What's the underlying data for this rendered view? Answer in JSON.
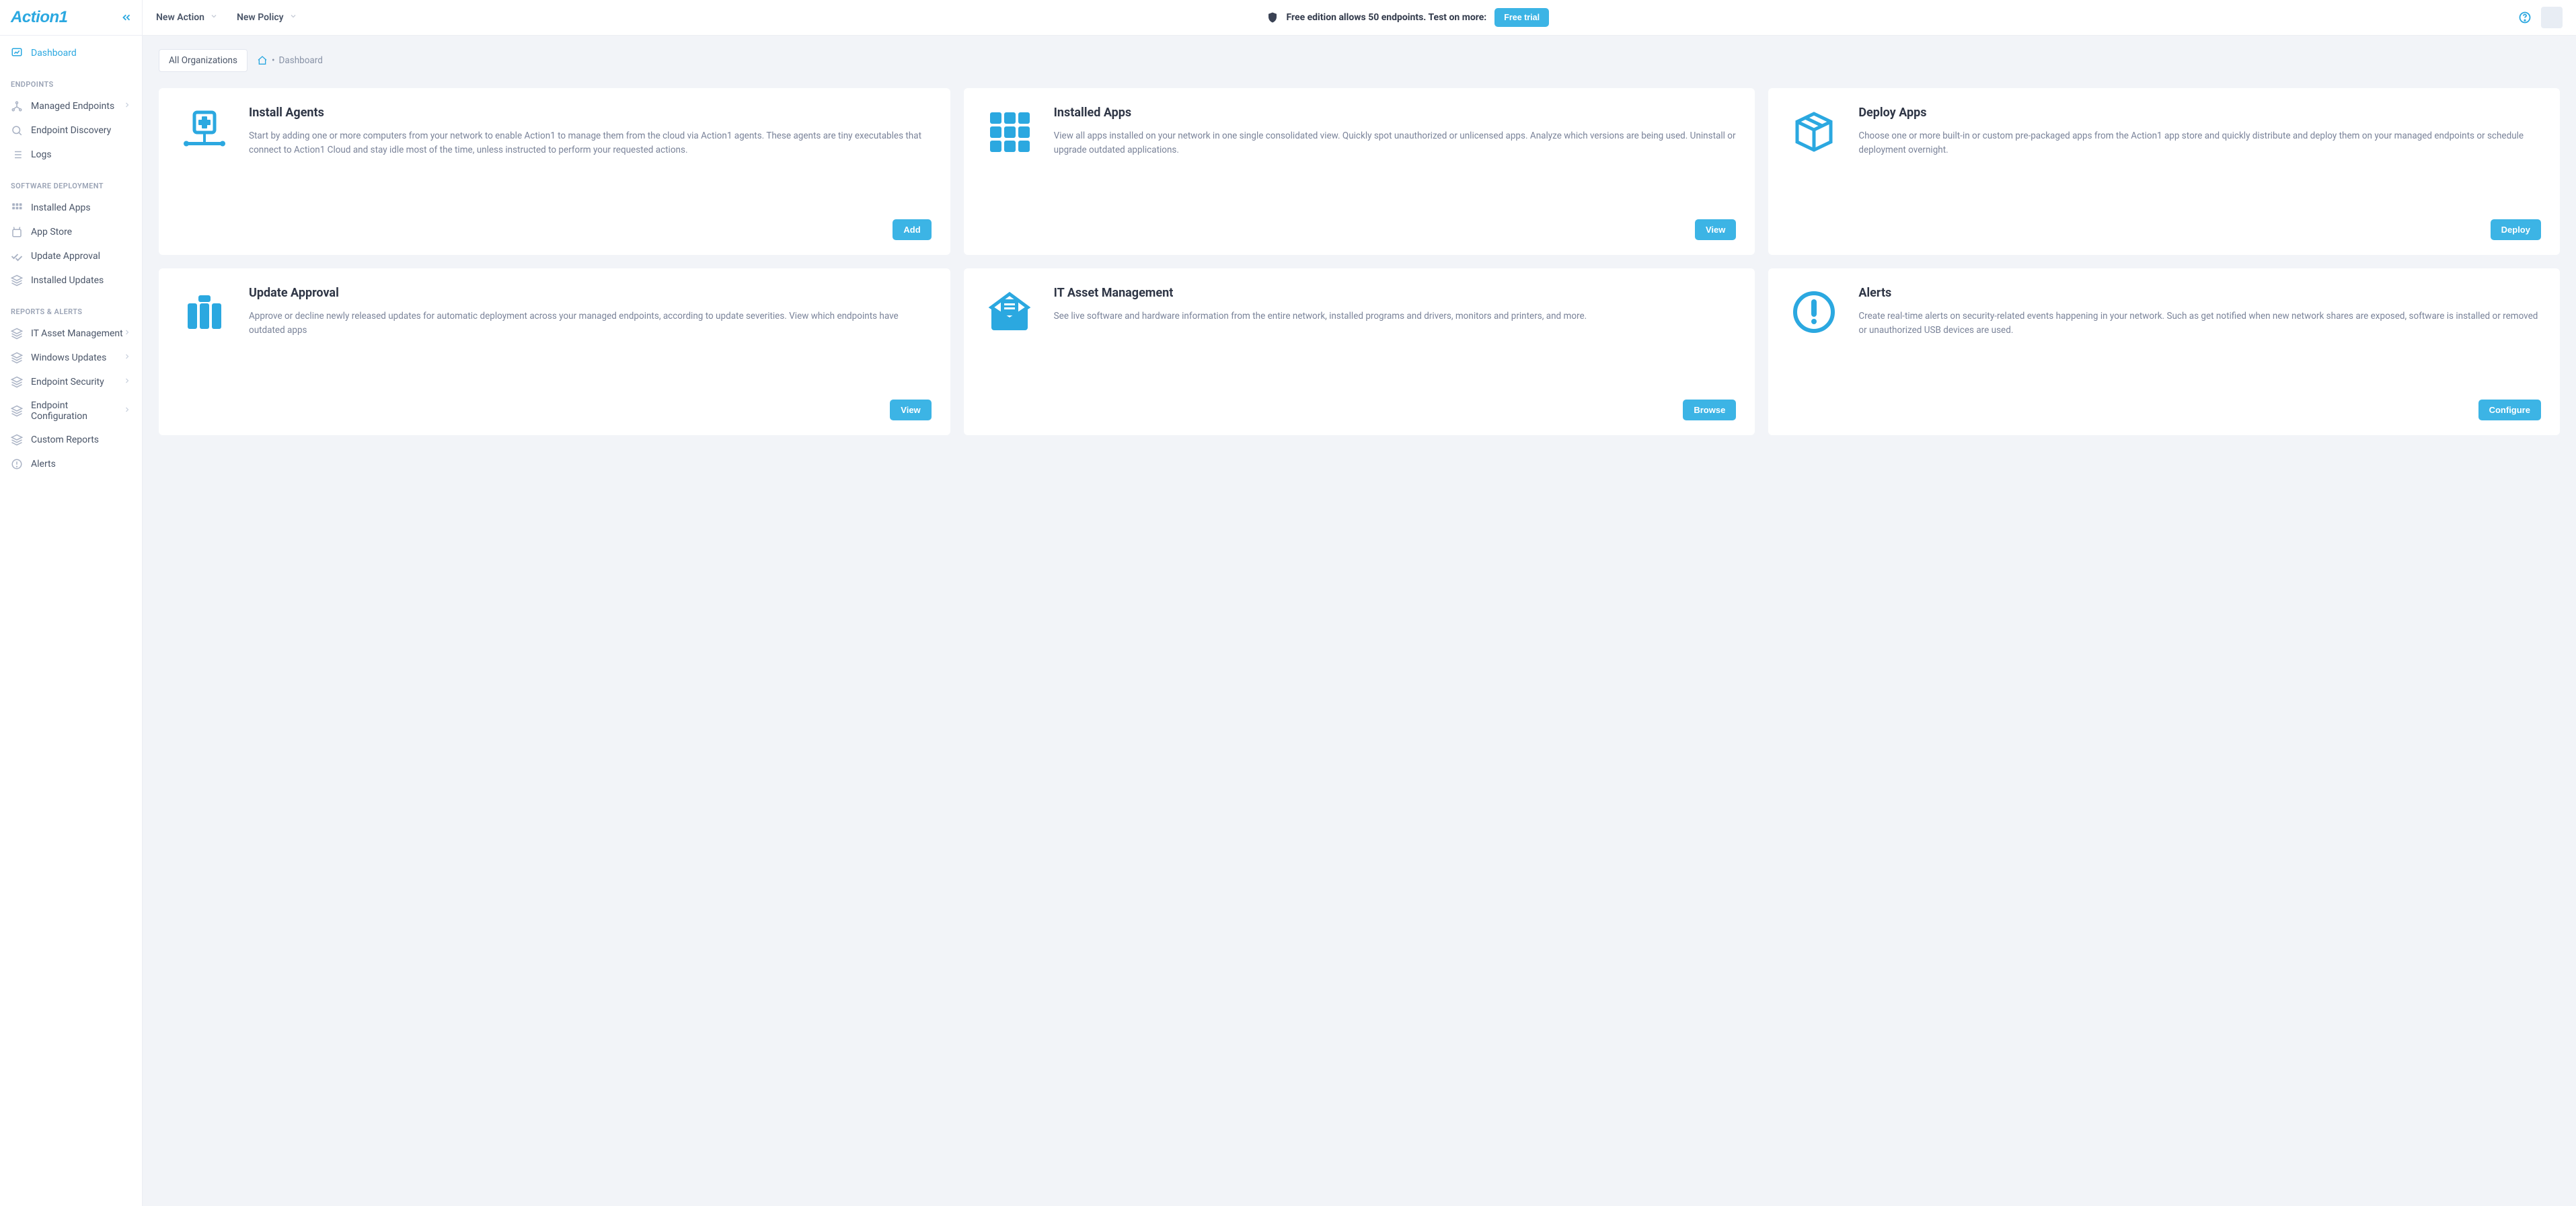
{
  "logo": "Action1",
  "topbar": {
    "new_action": "New Action",
    "new_policy": "New Policy",
    "banner": "Free edition allows 50 endpoints. Test on more:",
    "trial_btn": "Free trial"
  },
  "sidebar": {
    "dashboard": "Dashboard",
    "sections": {
      "endpoints": "ENDPOINTS",
      "software": "SOFTWARE DEPLOYMENT",
      "reports": "REPORTS & ALERTS"
    },
    "items": {
      "managed_endpoints": "Managed Endpoints",
      "endpoint_discovery": "Endpoint Discovery",
      "logs": "Logs",
      "installed_apps": "Installed Apps",
      "app_store": "App Store",
      "update_approval": "Update Approval",
      "installed_updates": "Installed Updates",
      "it_asset": "IT Asset Management",
      "windows_updates": "Windows Updates",
      "endpoint_security": "Endpoint Security",
      "endpoint_config": "Endpoint Configuration",
      "custom_reports": "Custom Reports",
      "alerts": "Alerts"
    }
  },
  "crumb": {
    "org": "All Organizations",
    "page": "Dashboard"
  },
  "cards": {
    "install_agents": {
      "title": "Install Agents",
      "desc": "Start by adding one or more computers from your network to enable Action1 to manage them from the cloud via Action1 agents. These agents are tiny executables that connect to Action1 Cloud and stay idle most of the time, unless instructed to perform your requested actions.",
      "btn": "Add"
    },
    "installed_apps": {
      "title": "Installed Apps",
      "desc": "View all apps installed on your network in one single consolidated view. Quickly spot unauthorized or unlicensed apps. Analyze which versions are being used. Uninstall or upgrade outdated applications.",
      "btn": "View"
    },
    "deploy_apps": {
      "title": "Deploy Apps",
      "desc": "Choose one or more built-in or custom pre-packaged apps from the Action1 app store and quickly distribute and deploy them on your managed endpoints or schedule deployment overnight.",
      "btn": "Deploy"
    },
    "update_approval": {
      "title": "Update Approval",
      "desc": "Approve or decline newly released updates for automatic deployment across your managed endpoints, according to update severities. View which endpoints have outdated apps",
      "btn": "View"
    },
    "it_asset": {
      "title": "IT Asset Management",
      "desc": "See live software and hardware information from the entire network, installed programs and drivers, monitors and printers, and more.",
      "btn": "Browse"
    },
    "alerts": {
      "title": "Alerts",
      "desc": "Create real-time alerts on security-related events happening in your network. Such as get notified when new network shares are exposed, software is installed or removed or unauthorized USB devices are used.",
      "btn": "Configure"
    }
  }
}
